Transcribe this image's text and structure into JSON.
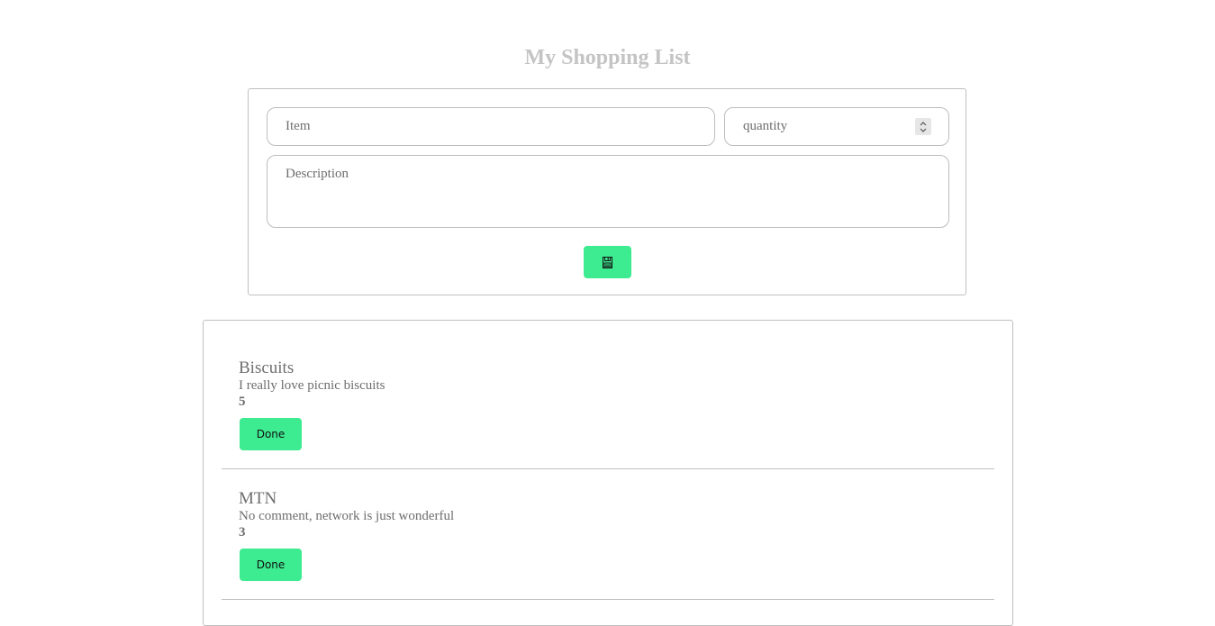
{
  "header": {
    "title": "My Shopping List"
  },
  "form": {
    "item_placeholder": "Item",
    "quantity_placeholder": "quantity",
    "description_placeholder": "Description",
    "save_icon": "floppy-disk-icon"
  },
  "items": [
    {
      "name": "Biscuits",
      "description": "I really love picnic biscuits",
      "quantity": "5",
      "done_label": "Done"
    },
    {
      "name": "MTN",
      "description": "No comment, network is just wonderful",
      "quantity": "3",
      "done_label": "Done"
    }
  ],
  "colors": {
    "accent": "#3deb91",
    "title": "#c4c4c4",
    "text": "#6e6e6e",
    "border": "#c0c0c0"
  }
}
